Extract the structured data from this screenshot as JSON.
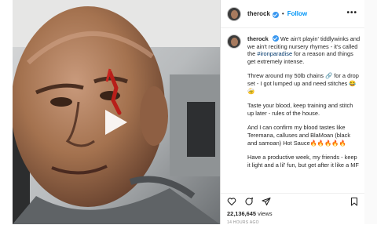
{
  "post": {
    "username": "therock",
    "dot": "•",
    "follow_label": "Follow",
    "more_label": "•••",
    "caption": {
      "username": "therock",
      "p1_text": "We ain't playin' tiddlywinks and we ain't reciting nursery rhymes - it's called the ",
      "p1_hashtag": "#ironparadise",
      "p1_rest": " for a reason and things get extremely intense.",
      "p2": "Threw around my 50lb chains 🔗 for a drop set - I got lumped up and need stitches 😂🤕",
      "p3": "Taste your blood, keep training and stitch up later - rules of the house.",
      "p4": "And I can confirm my blood tastes like Teremana, calluses and BlaMoan (black and samoan) Hot Sauce🔥🔥🔥🔥🔥",
      "p5": "Have a productive week, my friends - keep it light and a lil' fun, but get after it like a MF"
    },
    "likes_count": "22,136,645",
    "likes_label": "views",
    "time_ago": "14 HOURS AGO"
  },
  "media": {
    "type": "video",
    "description_icon": "play-icon"
  },
  "colors": {
    "accent": "#0095f6",
    "verified": "#3897f0",
    "text": "#262626"
  }
}
